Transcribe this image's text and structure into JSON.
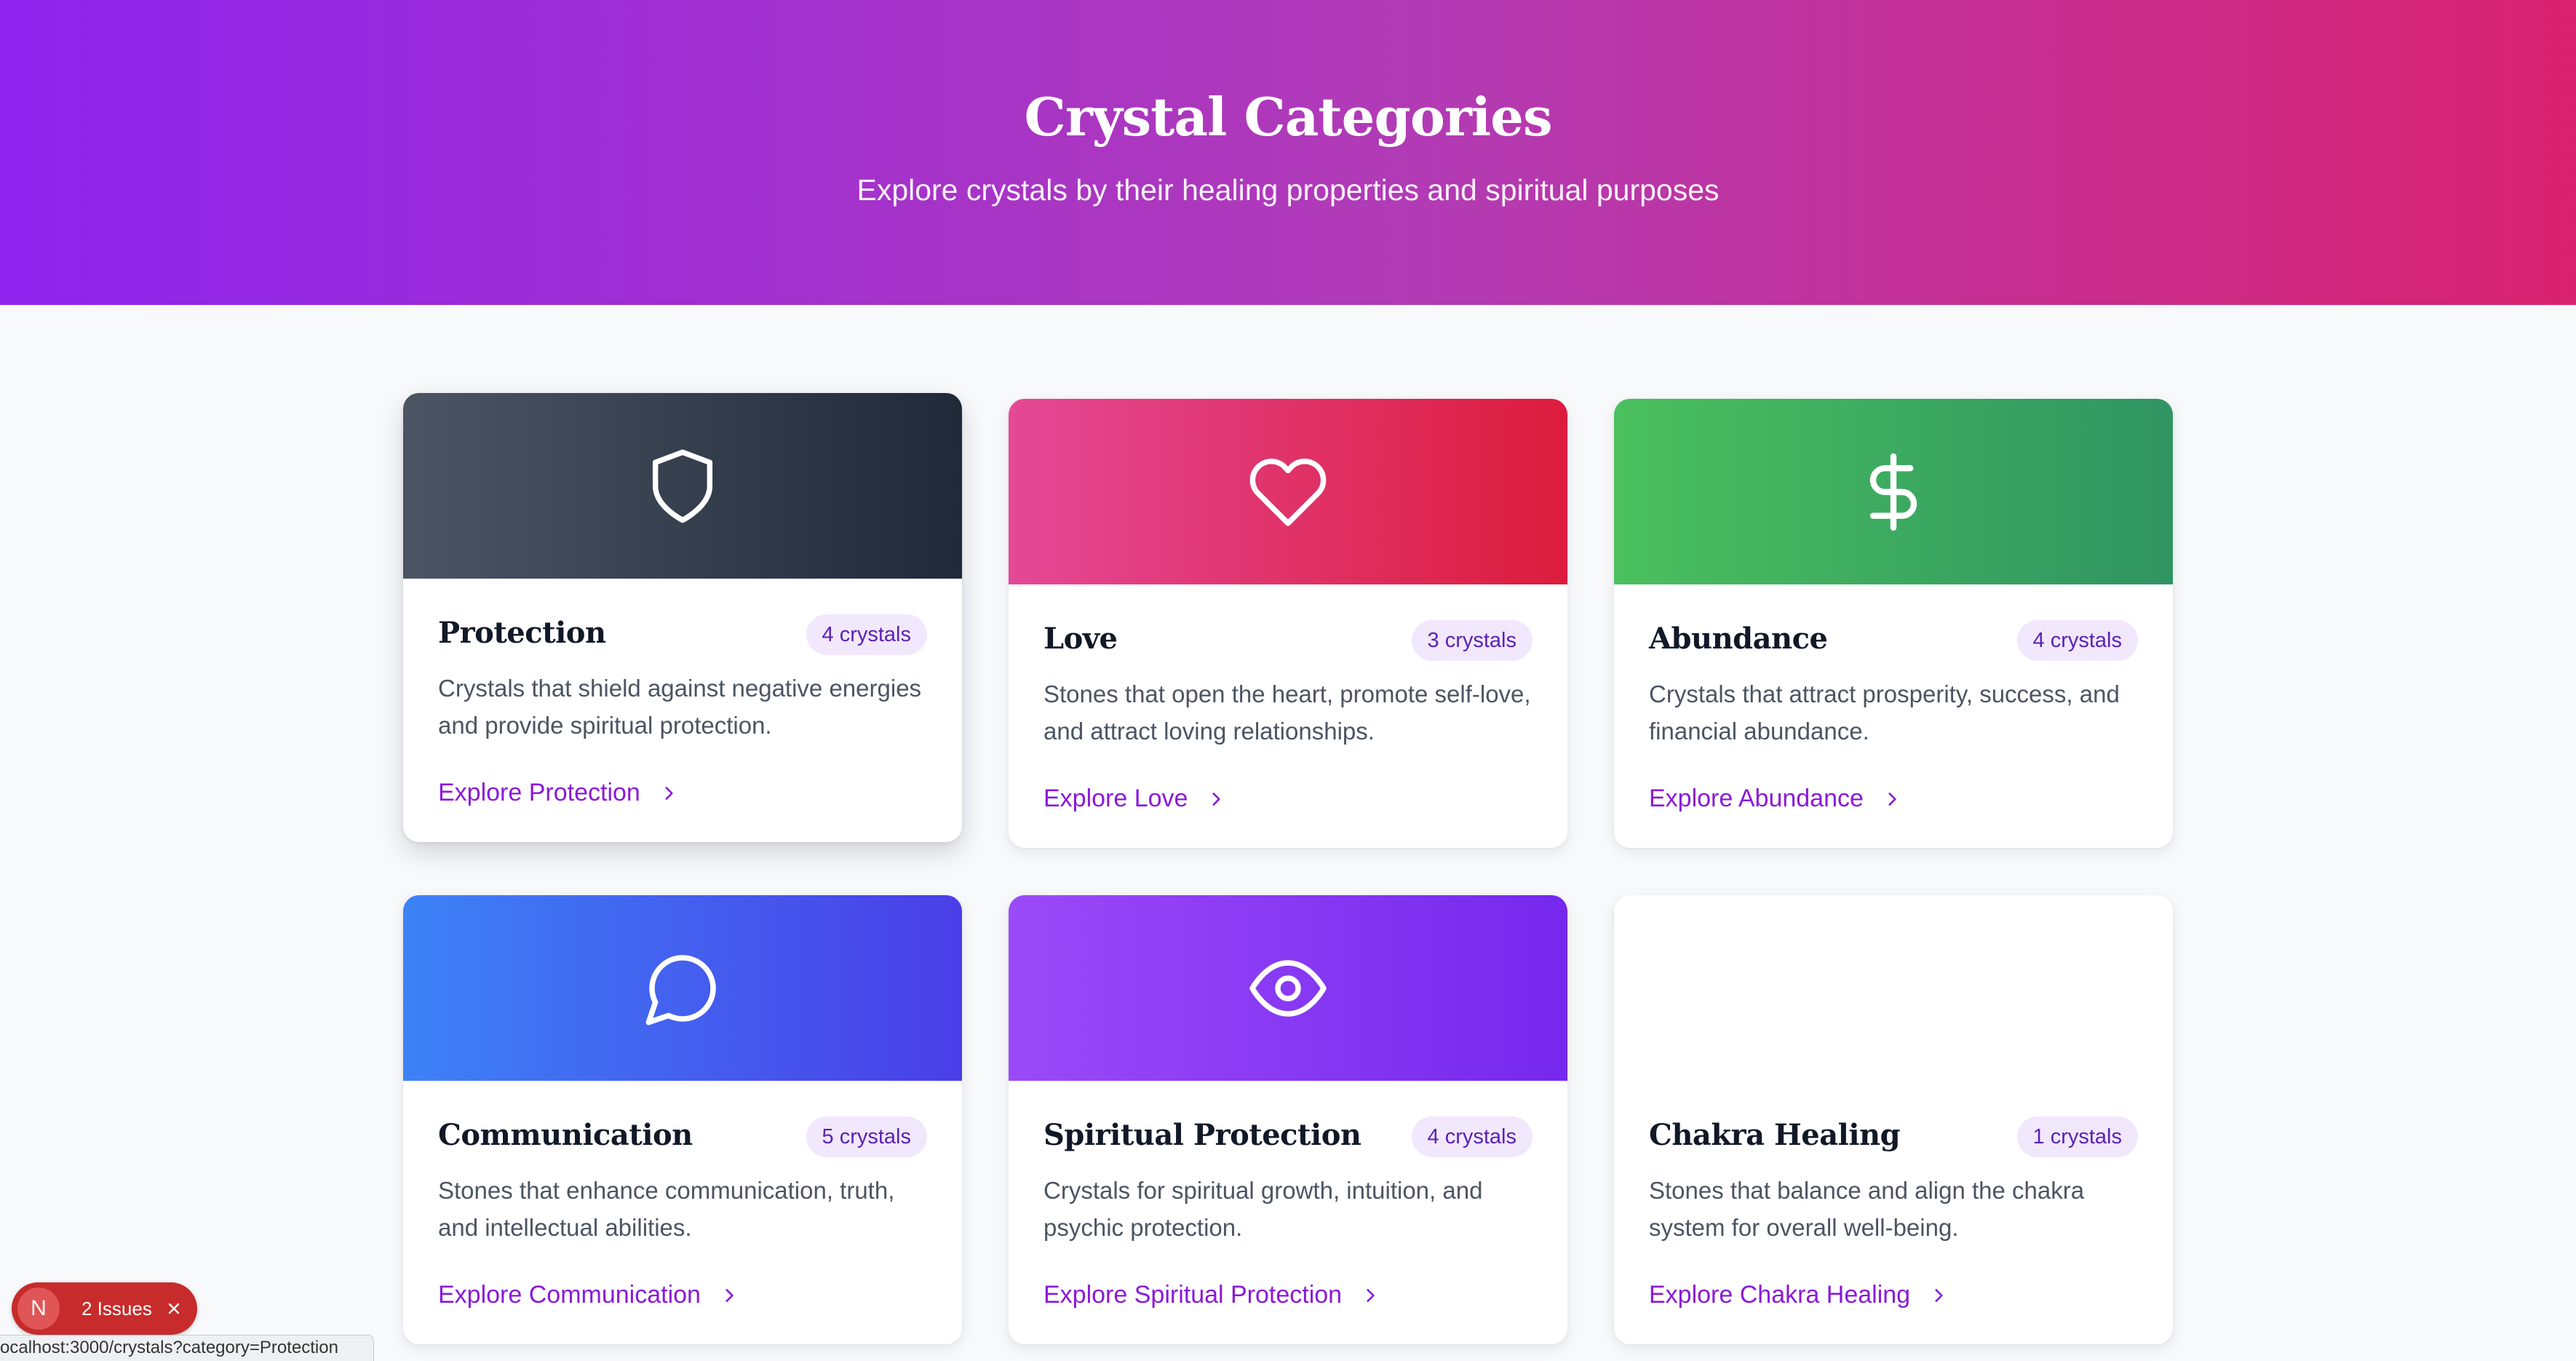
{
  "hero": {
    "title": "Crystal Categories",
    "subtitle": "Explore crystals by their healing properties and spiritual purposes"
  },
  "categories": [
    {
      "title": "Protection",
      "badge": "4 crystals",
      "description": "Crystals that shield against negative energies and provide spiritual protection.",
      "link": "Explore Protection",
      "icon": "shield-icon",
      "gradient": [
        "#4b5563",
        "#1f2937"
      ]
    },
    {
      "title": "Love",
      "badge": "3 crystals",
      "description": "Stones that open the heart, promote self-love, and attract loving relationships.",
      "link": "Explore Love",
      "icon": "heart-icon",
      "gradient": [
        "#e44996",
        "#dc1c3c"
      ]
    },
    {
      "title": "Abundance",
      "badge": "4 crystals",
      "description": "Crystals that attract prosperity, success, and financial abundance.",
      "link": "Explore Abundance",
      "icon": "dollar-icon",
      "gradient": [
        "#4ac05e",
        "#2f9462"
      ]
    },
    {
      "title": "Communication",
      "badge": "5 crystals",
      "description": "Stones that enhance communication, truth, and intellectual abilities.",
      "link": "Explore Communication",
      "icon": "message-circle-icon",
      "gradient": [
        "#3d82f6",
        "#4a3ee8"
      ]
    },
    {
      "title": "Spiritual Protection",
      "badge": "4 crystals",
      "description": "Crystals for spiritual growth, intuition, and psychic protection.",
      "link": "Explore Spiritual Protection",
      "icon": "eye-icon",
      "gradient": [
        "#9b4af8",
        "#7528ee"
      ]
    },
    {
      "title": "Chakra Healing",
      "badge": "1 crystals",
      "description": "Stones that balance and align the chakra system for overall well-being.",
      "link": "Explore Chakra Healing",
      "icon": "",
      "gradient": [
        "#ffffff",
        "#ffffff"
      ]
    }
  ],
  "dev_overlay": {
    "badge_letter": "N",
    "issues_label": "2 Issues"
  },
  "status_bar": {
    "url": "ocalhost:3000/crystals?category=Protection"
  }
}
